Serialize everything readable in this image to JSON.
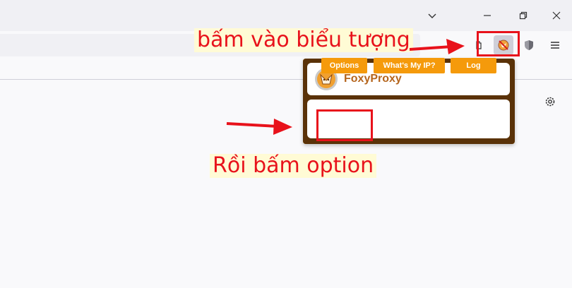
{
  "browser": {
    "window_controls": [
      "list-all-tabs",
      "minimize",
      "restore",
      "close"
    ],
    "toolbar_icons": [
      "extensions-icon",
      "foxyproxy-icon",
      "shield-icon",
      "hamburger-menu-icon"
    ],
    "settings_icon": "gear-icon"
  },
  "annotations": {
    "top_text": "bấm vào biểu tượng",
    "bottom_text": "Rồi bấm option",
    "color": "#e8121b"
  },
  "popup": {
    "title": "FoxyProxy",
    "buttons": {
      "options": "Options",
      "whats_my_ip": "What's My IP?",
      "log": "Log"
    },
    "accent": "#f59a0b",
    "frame": "#5a3208"
  }
}
